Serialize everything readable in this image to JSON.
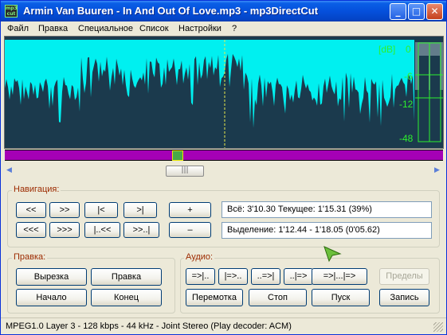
{
  "window": {
    "title": "Armin Van Buuren - In And Out Of Love.mp3 - mp3DirectCut",
    "app_icon_text": "mp3 cut",
    "controls": {
      "minimize": "_",
      "maximize": "□",
      "close": "✕"
    }
  },
  "menu": [
    {
      "label": "Файл"
    },
    {
      "label": "Правка"
    },
    {
      "label": "Специальное"
    },
    {
      "label": "Список"
    },
    {
      "label": "Настройки"
    },
    {
      "label": "?"
    }
  ],
  "waveform": {
    "db_labels": [
      "[dB]",
      "0",
      "-6",
      "-12",
      "-48"
    ],
    "colors": {
      "wave": "#00f0f0",
      "background": "#1b3a4d",
      "meter": "#2ef02e",
      "playhead": "#e8e84a"
    }
  },
  "navigation": {
    "label": "Навигация:",
    "buttons_row1": [
      "<<",
      ">>",
      "|<",
      ">|"
    ],
    "buttons_row2": [
      "<<<",
      ">>>",
      "|..<<",
      ">>..|"
    ],
    "zoom_in": "+",
    "zoom_out": "–",
    "info_line": "Всё: 3'10.30  Текущее: 1'15.31  (39%)",
    "selection_line": "Выделение: 1'12.44 - 1'18.05 (0'05.62)"
  },
  "edit": {
    "label": "Правка:",
    "cut": "Вырезка",
    "edit": "Правка",
    "start": "Начало",
    "end": "Конец"
  },
  "audio": {
    "label": "Аудио:",
    "row1": [
      "=>|..",
      "|=>..",
      "..=>|",
      "..|=>",
      "=>|...|=>"
    ],
    "limits": "Пределы",
    "rewind": "Перемотка",
    "stop": "Стоп",
    "play": "Пуск",
    "record": "Запись"
  },
  "status": {
    "text": "MPEG1.0 Layer 3 - 128 kbps - 44 kHz - Joint Stereo   (Play decoder: ACM)"
  }
}
